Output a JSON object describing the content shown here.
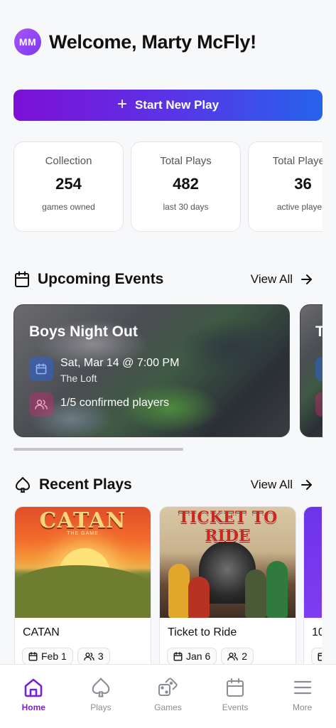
{
  "header": {
    "avatar_initials": "MM",
    "welcome": "Welcome, Marty McFly!"
  },
  "start_button": {
    "label": "Start New Play"
  },
  "stats": [
    {
      "label": "Collection",
      "value": "254",
      "sub": "games owned"
    },
    {
      "label": "Total Plays",
      "value": "482",
      "sub": "last 30 days"
    },
    {
      "label": "Total Players",
      "value": "36",
      "sub": "active players"
    }
  ],
  "events": {
    "title": "Upcoming Events",
    "view_all": "View All",
    "items": [
      {
        "title": "Boys Night Out",
        "datetime": "Sat, Mar 14 @ 7:00 PM",
        "location": "The Loft",
        "players": "1/5 confirmed players"
      },
      {
        "title": "T"
      }
    ]
  },
  "plays": {
    "title": "Recent Plays",
    "view_all": "View All",
    "items": [
      {
        "name": "CATAN",
        "date": "Feb 1",
        "players": "3",
        "cover_title": "CATAN",
        "cover_sub": "THE GAME"
      },
      {
        "name": "Ticket to Ride",
        "date": "Jan 6",
        "players": "2",
        "cover_title": "TICKET TO RIDE"
      },
      {
        "name": "10"
      }
    ]
  },
  "tabs": [
    {
      "label": "Home",
      "icon": "home-icon",
      "active": true
    },
    {
      "label": "Plays",
      "icon": "spade-icon",
      "active": false
    },
    {
      "label": "Games",
      "icon": "dice-icon",
      "active": false
    },
    {
      "label": "Events",
      "icon": "calendar-icon",
      "active": false
    },
    {
      "label": "More",
      "icon": "menu-icon",
      "active": false
    }
  ],
  "colors": {
    "accent": "#7a1fd6",
    "gradient_start": "#7e0fd6",
    "gradient_end": "#2563eb"
  }
}
